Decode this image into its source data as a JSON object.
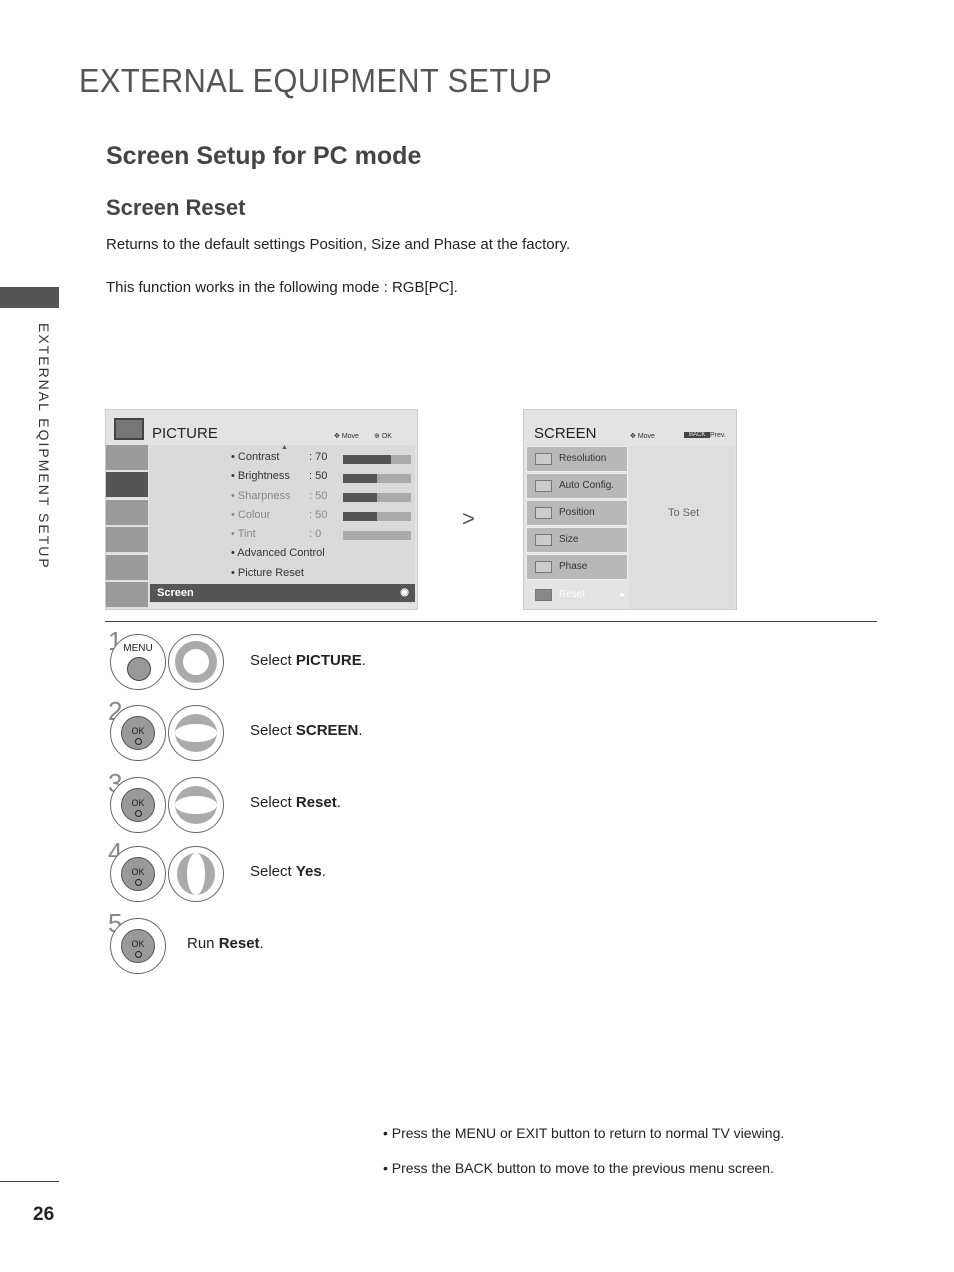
{
  "page": {
    "title": "EXTERNAL EQUIPMENT SETUP",
    "section": "Screen Setup for PC mode",
    "subsection": "Screen Reset",
    "para1": "Returns to the default settings Position, Size and Phase at the factory.",
    "para2": "This function works in the following mode : RGB[PC].",
    "side_label": "EXTERNAL EQIPMENT SETUP",
    "page_number": "26"
  },
  "picture_menu": {
    "title": "PICTURE",
    "move": "Move",
    "ok": "OK",
    "items": [
      {
        "label": "• Contrast",
        "value": ": 70",
        "level": 70
      },
      {
        "label": "• Brightness",
        "value": ": 50",
        "level": 50
      },
      {
        "label": "• Sharpness",
        "value": ": 50",
        "level": 50
      },
      {
        "label": "• Colour",
        "value": ": 50",
        "level": 50
      },
      {
        "label": "• Tint",
        "value": ": 0",
        "level": 0
      },
      {
        "label": "• Advanced Control"
      },
      {
        "label": "• Picture Reset"
      }
    ],
    "selected": "Screen"
  },
  "screen_menu": {
    "title": "SCREEN",
    "move": "Move",
    "back": "BACK",
    "prev": "Prev.",
    "items": [
      "Resolution",
      "Auto Config.",
      "Position",
      "Size",
      "Phase",
      "Reset"
    ],
    "hint": "To Set"
  },
  "steps": [
    {
      "num": "1",
      "pre": "Select ",
      "bold": "PICTURE",
      "post": ".",
      "button": "MENU"
    },
    {
      "num": "2",
      "pre": "Select ",
      "bold": "SCREEN",
      "post": ".",
      "button": "OK"
    },
    {
      "num": "3",
      "pre": "Select ",
      "bold": "Reset",
      "post": ".",
      "button": "OK"
    },
    {
      "num": "4",
      "pre": "Select ",
      "bold": "Yes",
      "post": ".",
      "button": "OK"
    },
    {
      "num": "5",
      "pre": "Run ",
      "bold": "Reset",
      "post": ".",
      "button": "OK"
    }
  ],
  "notes": [
    {
      "a": "• Press the ",
      "b1": "MENU",
      "c": " or ",
      "b2": "EXIT",
      "d": " button to return to normal TV viewing."
    },
    {
      "a": "• Press the ",
      "b1": "BACK",
      "c": " button to move to the previous menu screen."
    }
  ]
}
